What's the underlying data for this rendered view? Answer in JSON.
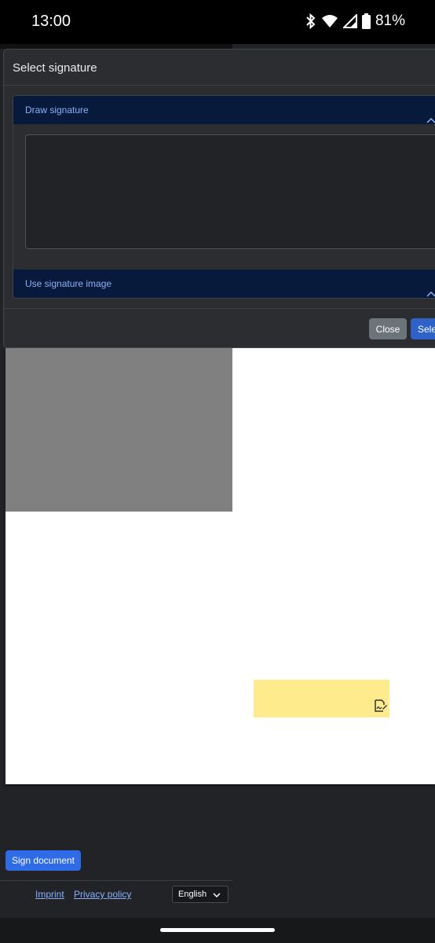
{
  "status_bar": {
    "time": "13:00",
    "battery": "81%"
  },
  "modal": {
    "title": "Select signature",
    "draw_section_label": "Draw signature",
    "image_section_label": "Use signature image",
    "close_label": "Close",
    "select_label": "Sele"
  },
  "page": {
    "sign_button_label": "Sign document",
    "footer": {
      "imprint": "Imprint",
      "privacy": "Privacy policy",
      "language": "English"
    }
  },
  "icons": {
    "signature_field": "signature-icon",
    "battery": "battery-icon",
    "wifi": "wifi-icon",
    "bluetooth": "bluetooth-icon",
    "signal": "signal-icon"
  },
  "colors": {
    "accent": "#2f6be6",
    "signature_field": "#fdeb8c",
    "accordion_header": "#071a3b"
  }
}
